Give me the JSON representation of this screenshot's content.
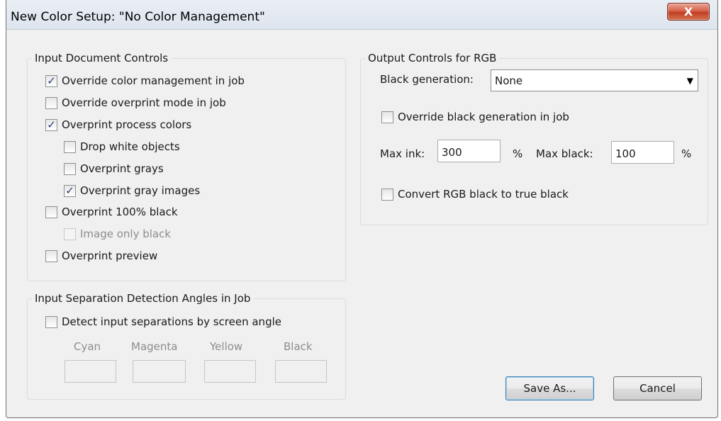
{
  "window": {
    "title": "New Color Setup: \"No Color Management\"",
    "close_glyph": "X"
  },
  "input_controls": {
    "legend": "Input Document Controls",
    "items": [
      {
        "label": "Override color management in job",
        "checked": true,
        "enabled": true
      },
      {
        "label": "Override overprint mode in job",
        "checked": false,
        "enabled": true
      },
      {
        "label": "Overprint process colors",
        "checked": true,
        "enabled": true
      },
      {
        "label": "Drop white objects",
        "checked": false,
        "enabled": true
      },
      {
        "label": "Overprint grays",
        "checked": false,
        "enabled": true
      },
      {
        "label": "Overprint gray images",
        "checked": true,
        "enabled": true
      },
      {
        "label": "Overprint 100% black",
        "checked": false,
        "enabled": true
      },
      {
        "label": "Image only black",
        "checked": false,
        "enabled": false
      },
      {
        "label": "Overprint preview",
        "checked": false,
        "enabled": true
      }
    ]
  },
  "separation": {
    "legend": "Input Separation Detection Angles in Job",
    "detect_label": "Detect input separations by screen angle",
    "detect_checked": false,
    "angles": [
      {
        "label": "Cyan",
        "value": ""
      },
      {
        "label": "Magenta",
        "value": ""
      },
      {
        "label": "Yellow",
        "value": ""
      },
      {
        "label": "Black",
        "value": ""
      }
    ]
  },
  "output": {
    "legend": "Output Controls for RGB",
    "black_generation_label": "Black generation:",
    "black_generation_value": "None",
    "override_label": "Override black generation in job",
    "override_checked": false,
    "max_ink_label": "Max ink:",
    "max_ink_value": "300",
    "max_ink_unit": "%",
    "max_black_label": "Max black:",
    "max_black_value": "100",
    "max_black_unit": "%",
    "convert_label": "Convert RGB black to true black",
    "convert_checked": false
  },
  "buttons": {
    "save_as": "Save As...",
    "cancel": "Cancel"
  },
  "icons": {
    "check": "✓",
    "dropdown": "▼"
  }
}
